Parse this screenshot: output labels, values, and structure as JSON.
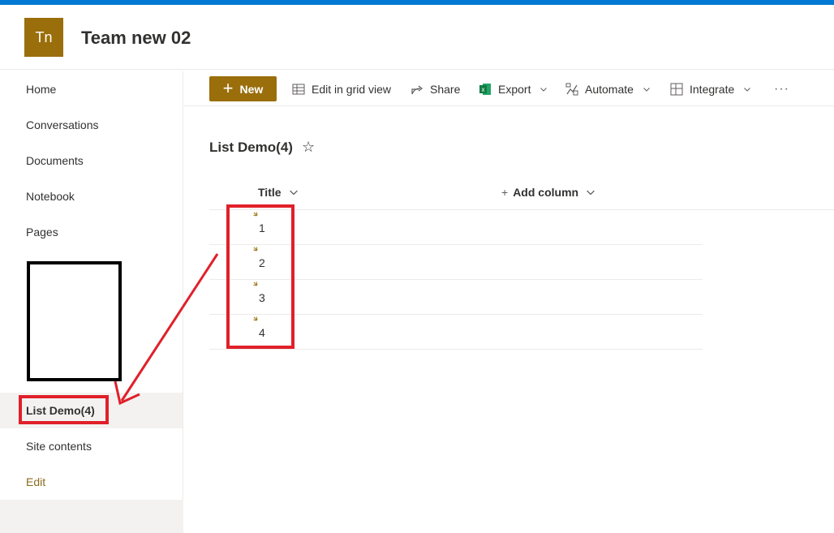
{
  "site": {
    "logo_initials": "Tn",
    "title": "Team new 02",
    "brand_color": "#9a6e0b",
    "suite_bar_color": "#0078d4"
  },
  "leftnav": {
    "items": [
      {
        "label": "Home"
      },
      {
        "label": "Conversations"
      },
      {
        "label": "Documents"
      },
      {
        "label": "Notebook"
      },
      {
        "label": "Pages"
      },
      {
        "label": "List Demo(4)",
        "selected": true
      },
      {
        "label": "Site contents"
      },
      {
        "label": "Edit"
      }
    ]
  },
  "commandbar": {
    "new_label": "New",
    "edit_grid_label": "Edit in grid view",
    "share_label": "Share",
    "export_label": "Export",
    "automate_label": "Automate",
    "integrate_label": "Integrate",
    "more_label": "···"
  },
  "list": {
    "title": "List Demo(4)",
    "columns": {
      "title_label": "Title",
      "add_label": "Add column"
    },
    "rows": [
      {
        "title": "1"
      },
      {
        "title": "2"
      },
      {
        "title": "3"
      },
      {
        "title": "4"
      }
    ]
  },
  "annotation_color": "#e0202a"
}
